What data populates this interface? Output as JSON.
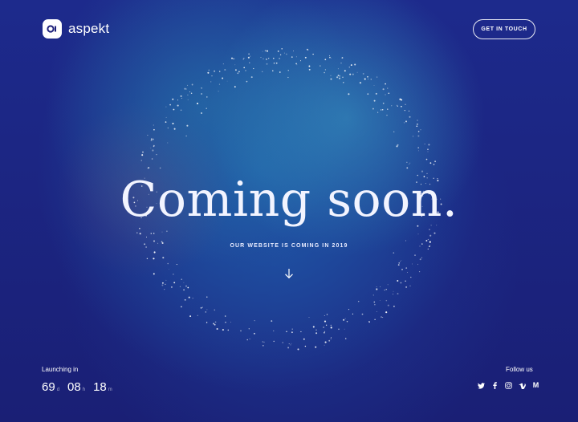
{
  "brand": {
    "name": "aspekt",
    "logo_icon": "aspekt-logo-icon"
  },
  "header": {
    "cta_label": "GET IN TOUCH"
  },
  "hero": {
    "headline": "Coming soon.",
    "subheadline": "OUR WEBSITE IS COMING IN 2019",
    "scroll_icon": "arrow-down-icon"
  },
  "countdown": {
    "label": "Launching in",
    "days": "69",
    "days_unit": "d",
    "hours": "08",
    "hours_unit": "h",
    "minutes": "18",
    "minutes_unit": "m"
  },
  "social": {
    "label": "Follow us",
    "icons": [
      "twitter-icon",
      "facebook-icon",
      "instagram-icon",
      "vimeo-icon",
      "medium-icon"
    ],
    "medium_glyph": "M"
  },
  "colors": {
    "background": "#1c1f7a",
    "accent": "#3a9ec4",
    "text": "#ffffff"
  }
}
